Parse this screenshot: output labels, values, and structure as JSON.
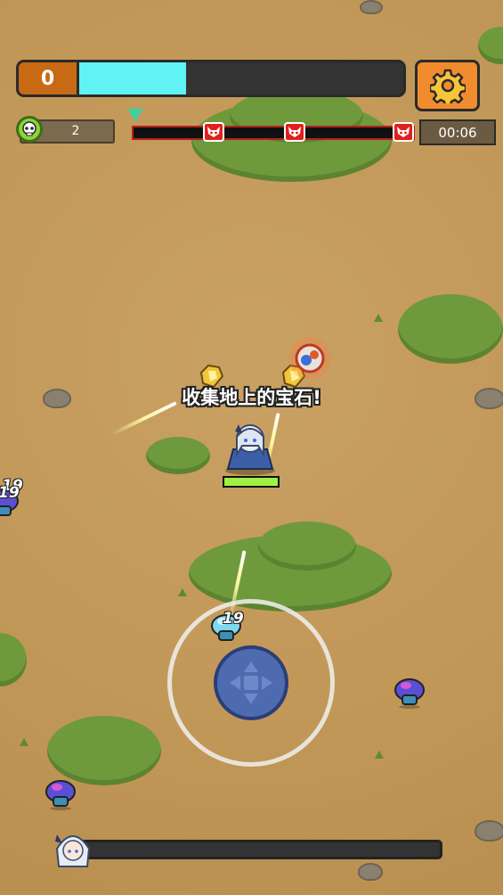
{
  "hud": {
    "level": "0",
    "xp_progress": 0.33,
    "kill_count": "2",
    "wave_progress": 0.0,
    "timer": "00:06",
    "boss_markers": 3
  },
  "hint": {
    "text": "收集地上的宝石!"
  },
  "hero": {
    "hp_progress": 1.0
  },
  "damage_numbers": [
    "19",
    "19",
    "19"
  ],
  "boss_bar": {
    "progress": 0.0
  },
  "icons": {
    "settings": "gear-icon",
    "kill": "skull-icon",
    "boss": "boss-demon-icon",
    "joystick": "dpad-arrows-icon",
    "wave_marker": "triangle-down-icon"
  },
  "colors": {
    "xp_fill": "#5ff3f6",
    "level_badge": "#c86a14",
    "settings_button": "#f08c2e",
    "hp_fill": "#9ef043",
    "boss_marker": "#e0201c",
    "joystick_knob": "#4f6bb0"
  }
}
